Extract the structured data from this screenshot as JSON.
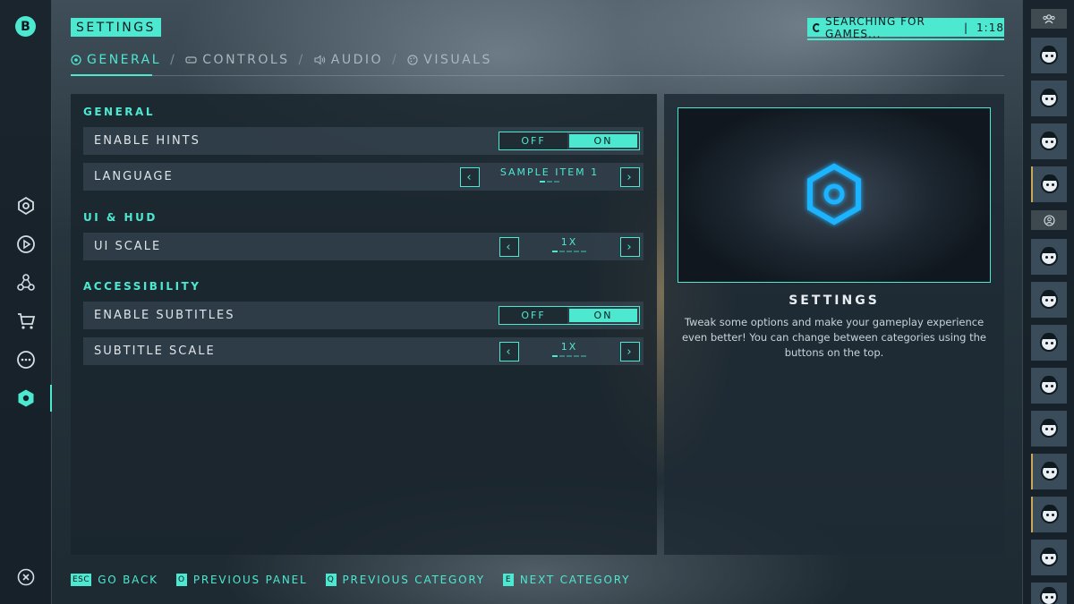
{
  "header": {
    "title": "SETTINGS",
    "tabs": [
      {
        "label": "GENERAL",
        "icon": "target-icon",
        "active": true
      },
      {
        "label": "CONTROLS",
        "icon": "gamepad-icon",
        "active": false
      },
      {
        "label": "AUDIO",
        "icon": "speaker-icon",
        "active": false
      },
      {
        "label": "VISUALS",
        "icon": "palette-icon",
        "active": false
      }
    ],
    "tab_separator": "/",
    "matchmaking": {
      "status": "SEARCHING FOR GAMES...",
      "separator": "|",
      "timer": "1:18"
    }
  },
  "sections": {
    "general": {
      "heading": "GENERAL",
      "enable_hints": {
        "label": "ENABLE HINTS",
        "off": "OFF",
        "on": "ON",
        "value": "ON"
      },
      "language": {
        "label": "LANGUAGE",
        "value": "SAMPLE ITEM 1",
        "prev": "‹",
        "next": "›",
        "option_count": 3,
        "selected_index": 0
      }
    },
    "ui_hud": {
      "heading": "UI & HUD",
      "ui_scale": {
        "label": "UI SCALE",
        "value": "1X",
        "prev": "‹",
        "next": "›",
        "option_count": 5,
        "selected_index": 0
      }
    },
    "accessibility": {
      "heading": "ACCESSIBILITY",
      "enable_subtitles": {
        "label": "ENABLE SUBTITLES",
        "off": "OFF",
        "on": "ON",
        "value": "ON"
      },
      "subtitle_scale": {
        "label": "SUBTITLE SCALE",
        "value": "1X",
        "prev": "‹",
        "next": "›",
        "option_count": 5,
        "selected_index": 0
      }
    }
  },
  "preview": {
    "title": "SETTINGS",
    "description": "Tweak some options and make your gameplay experience even better! You can change between categories using the buttons on the top."
  },
  "footer": {
    "hints": [
      {
        "key": "ESC",
        "label": "GO BACK"
      },
      {
        "key": "O",
        "label": "PREVIOUS PANEL"
      },
      {
        "key": "Q",
        "label": "PREVIOUS CATEGORY"
      },
      {
        "key": "E",
        "label": "NEXT CATEGORY"
      }
    ]
  },
  "sidebar": {
    "logo": "B",
    "items": [
      "home-icon",
      "play-icon",
      "social-icon",
      "cart-icon",
      "more-icon",
      "settings-icon"
    ],
    "active": "settings-icon",
    "bottom": "close-icon"
  },
  "colors": {
    "accent": "#4de8d0",
    "dark": "#0f1a20",
    "gold": "#c9a85a"
  }
}
